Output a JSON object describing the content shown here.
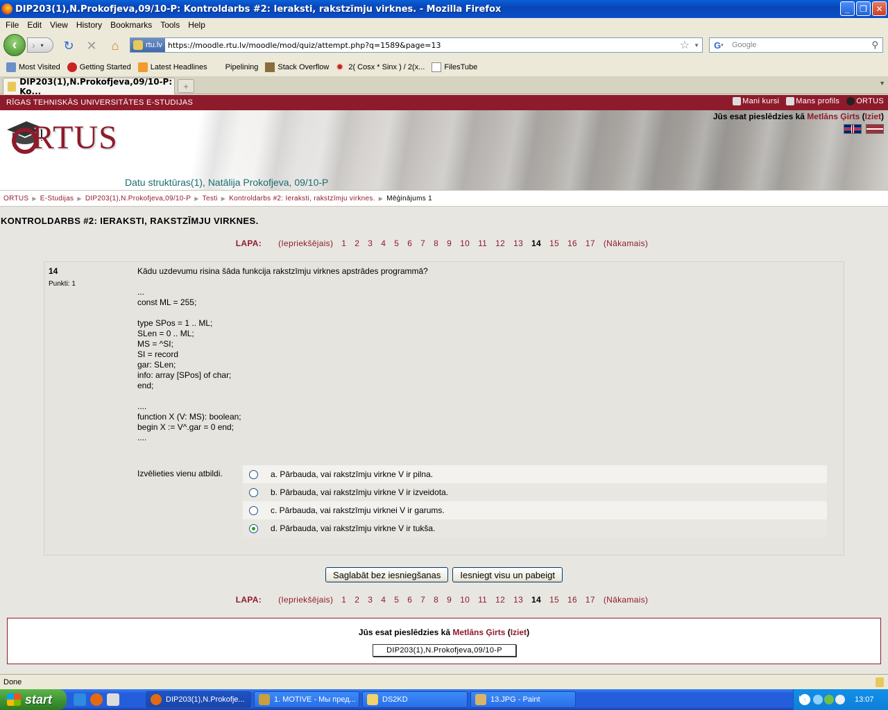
{
  "window": {
    "title": "DIP203(1),N.Prokofjeva,09/10-P: Kontroldarbs #2: Ieraksti, rakstzīmju virknes. - Mozilla Firefox"
  },
  "menu": [
    "File",
    "Edit",
    "View",
    "History",
    "Bookmarks",
    "Tools",
    "Help"
  ],
  "navbar": {
    "site_identity": "rtu.lv",
    "url": "https://moodle.rtu.lv/moodle/mod/quiz/attempt.php?q=1589&page=13",
    "search_placeholder": "Google"
  },
  "bookmarks": [
    "Most Visited",
    "Getting Started",
    "Latest Headlines",
    "Pipelining",
    "Stack Overflow",
    "2( Cosx * Sinx ) / 2(x...",
    "FilesTube"
  ],
  "tab": {
    "label": "DIP203(1),N.Prokofjeva,09/10-P: Ko..."
  },
  "site": {
    "university": "RĪGAS TEHNISKĀS UNIVERSITĀTES E-STUDIJAS",
    "top_links": [
      "Mani kursi",
      "Mans profils",
      "ORTUS"
    ],
    "logo_text": "RTUS",
    "course_title": "Datu struktūras(1), Natālija Prokofjeva, 09/10-P",
    "login_prefix": "Jūs esat pieslēdzies kā",
    "user_name": "Metlāns Ģirts",
    "logout": "Iziet"
  },
  "breadcrumb": [
    "ORTUS",
    "E-Studijas",
    "DIP203(1),N.Prokofjeva,09/10-P",
    "Testi",
    "Kontroldarbs #2: Ieraksti, rakstzīmju virknes.",
    "Mēģinājums 1"
  ],
  "quiz": {
    "title": "KONTROLDARBS #2: IERAKSTI, RAKSTZĪMJU VIRKNES.",
    "pager_label": "LAPA:",
    "prev": "(Iepriekšējais)",
    "next": "(Nākamais)",
    "pages": [
      "1",
      "2",
      "3",
      "4",
      "5",
      "6",
      "7",
      "8",
      "9",
      "10",
      "11",
      "12",
      "13",
      "14",
      "15",
      "16",
      "17"
    ],
    "current_page": "14",
    "question": {
      "number": "14",
      "points": "Punkti: 1",
      "text": "Kādu uzdevumu risina šāda funkcija rakstzīmju virknes apstrādes programmā?\n\n...\nconst ML = 255;\n\ntype SPos = 1 .. ML;\nSLen = 0 .. ML;\nMS = ^SI;\nSI = record\ngar: SLen;\ninfo: array [SPos] of char;\nend;\n\n....\nfunction X (V: MS): boolean;\nbegin X := V^.gar = 0 end;\n....",
      "choose_label": "Izvēlieties vienu atbildi.",
      "answers": [
        "a. Pārbauda, vai rakstzīmju virkne V ir pilna.",
        "b. Pārbauda, vai rakstzīmju virkne V ir izveidota.",
        "c. Pārbauda, vai rakstzīmju virknei V ir garums.",
        "d. Pārbauda, vai rakstzīmju virkne V ir tukša."
      ],
      "selected_answer": "d"
    },
    "save_button": "Saglabāt bez iesniegšanas",
    "submit_button": "Iesniegt visu un pabeigt"
  },
  "footer": {
    "course_button": "DIP203(1),N.Prokofjeva,09/10-P"
  },
  "status": "Done",
  "taskbar": {
    "start": "start",
    "tasks": [
      "DIP203(1),N.Prokofje...",
      "1. MOTIVE - Мы пред...",
      "DS2KD",
      "13.JPG - Paint"
    ],
    "lang": "LV",
    "time": "13:07"
  }
}
